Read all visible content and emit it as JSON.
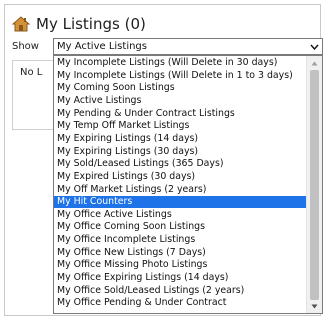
{
  "header": {
    "title": "My Listings (0)",
    "icon": "house-icon",
    "icon_color": "#c8842a"
  },
  "filter": {
    "label": "Show",
    "selected_value": "My Active Listings"
  },
  "results": {
    "empty_text": "No L"
  },
  "dropdown": {
    "selected_color": "#1e73e8",
    "options": [
      "My Incomplete Listings (Will Delete in 30 days)",
      "My Incomplete Listings (Will Delete in 1 to 3 days)",
      "My Coming Soon Listings",
      "My Active Listings",
      "My Pending & Under Contract Listings",
      "My Temp Off Market Listings",
      "My Expiring Listings (14 days)",
      "My Expiring Listings (30 days)",
      "My Sold/Leased Listings (365 Days)",
      "My Expired Listings (30 days)",
      "My Off Market Listings (2 years)",
      "My Hit Counters",
      "My Office Active Listings",
      "My Office Coming Soon Listings",
      "My Office Incomplete Listings",
      "My Office New Listings (7 Days)",
      "My Office Missing Photo Listings",
      "My Office Expiring Listings (14 days)",
      "My Office Sold/Leased Listings (2 years)",
      "My Office Pending & Under Contract"
    ],
    "highlighted_option": "My Hit Counters"
  }
}
